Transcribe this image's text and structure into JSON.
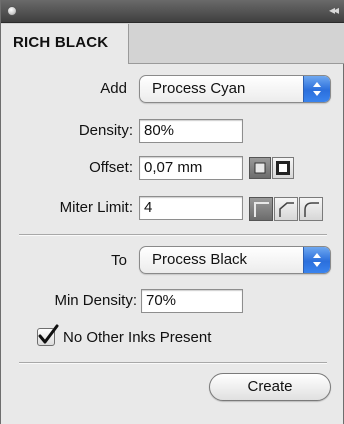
{
  "panel": {
    "tab_label": "RICH BLACK"
  },
  "add": {
    "label": "Add",
    "selected": "Process Cyan"
  },
  "density": {
    "label": "Density:",
    "value": "80%"
  },
  "offset": {
    "label": "Offset:",
    "value": "0,07 mm"
  },
  "miter": {
    "label": "Miter Limit:",
    "value": "4"
  },
  "to": {
    "label": "To",
    "selected": "Process Black"
  },
  "min_density": {
    "label": "Min Density:",
    "value": "70%"
  },
  "no_other_inks": {
    "label": "No Other Inks Present",
    "checked": true
  },
  "create_button": {
    "label": "Create"
  },
  "colors": {
    "popup_arrow": "#2b6fdc",
    "panel_bg": "#e9e9e9"
  }
}
